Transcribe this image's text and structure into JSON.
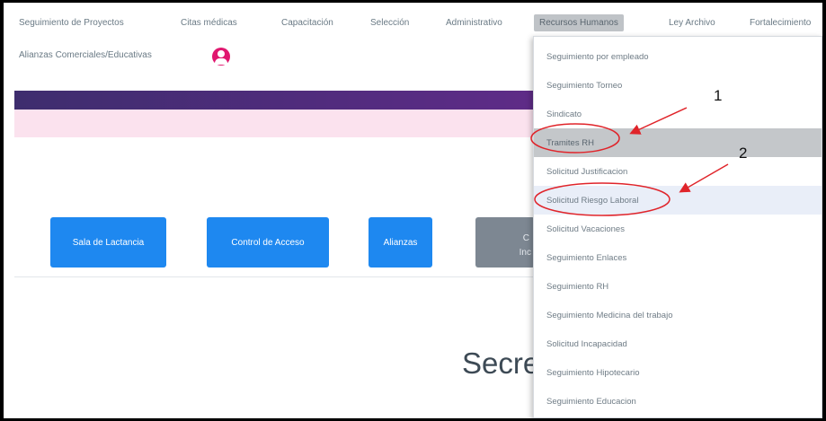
{
  "nav": {
    "items": [
      "Seguimiento de Proyectos",
      "Citas médicas",
      "Capacitación",
      "Selección",
      "Administrativo",
      "Recursos Humanos",
      "Ley Archivo",
      "Fortalecimiento"
    ],
    "second_row": "Alianzas Comerciales/Educativas",
    "active_item": "Recursos Humanos"
  },
  "buttons": {
    "sala": "Sala de Lactancia",
    "control": "Control de Acceso",
    "alianzas": "Alianzas",
    "partial_top": "C",
    "partial_bottom": "Inc"
  },
  "main": {
    "title_partial": "Secre"
  },
  "dropdown": {
    "items": [
      "Seguimiento por empleado",
      "Seguimiento Torneo",
      "Sindicato",
      "Tramites RH",
      "Solicitud Justificacion",
      "Solicitud Riesgo Laboral",
      "Solicitud Vacaciones",
      "Seguimiento Enlaces",
      "Seguimiento RH",
      "Seguimiento Medicina del trabajo",
      "Solicitud Incapacidad",
      "Seguimiento Hipotecario",
      "Seguimiento Educacion"
    ],
    "highlighted_item": "Tramites RH",
    "hovered_item": "Solicitud Riesgo Laboral"
  },
  "annotations": {
    "label_1": "1",
    "label_2": "2",
    "color": "#e0242a"
  },
  "colors": {
    "primary_button": "#1e88f0",
    "header_gradient_start": "#3e2d6e",
    "header_gradient_end": "#7a2a8f",
    "pink_band": "#fbe2ee",
    "avatar": "#e0176f"
  }
}
